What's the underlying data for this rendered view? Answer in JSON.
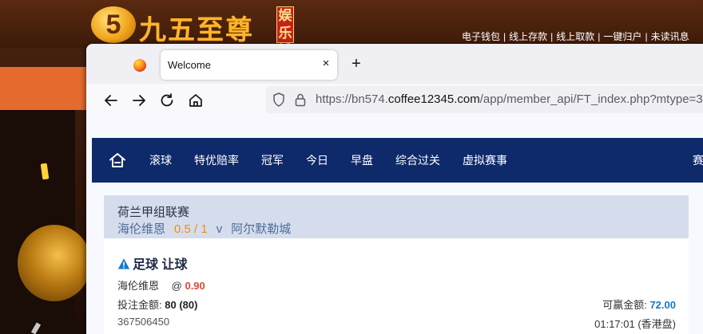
{
  "background_site": {
    "logo_number": "5",
    "logo_text": "九五至尊",
    "logo_badge": "娱乐城",
    "top_links": [
      "电子钱包",
      "线上存款",
      "线上取款",
      "一键归户",
      "未读讯息"
    ],
    "separator": "|"
  },
  "browser": {
    "tab_title": "Welcome",
    "tab_close": "×",
    "new_tab": "+",
    "url_prefix": "https://bn574.",
    "url_domain": "coffee12345.com",
    "url_path": "/app/member_api/FT_index.php?mtype=3"
  },
  "site_nav": {
    "items": [
      "滚球",
      "特优赔率",
      "冠军",
      "今日",
      "早盘",
      "综合过关",
      "虚拟赛事"
    ],
    "extra": "赛"
  },
  "bet": {
    "league": "荷兰甲组联赛",
    "home_team": "海伦维恩",
    "handicap": "0.5 / 1",
    "vs": "v",
    "away_team": "阿尔默勒城",
    "bet_type": "足球 让球",
    "selection": "海伦维恩",
    "at": "@",
    "odds": "0.90",
    "stake_label": "投注金额:",
    "stake_value": "80 (80)",
    "win_label": "可赢金额:",
    "win_value": "72.00",
    "ticket_id": "367506450",
    "time": "01:17:01 (香港盘)"
  },
  "colors": {
    "nav_bg": "#0f2a6b",
    "match_header_bg": "#d5ddec",
    "handicap": "#f08c1e",
    "odds": "#e0463b",
    "win_value": "#1479c9"
  }
}
